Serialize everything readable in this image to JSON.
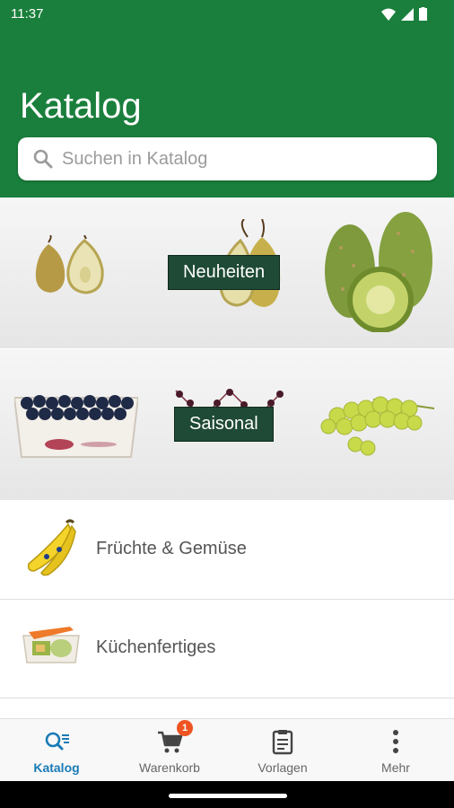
{
  "status_bar": {
    "time": "11:37"
  },
  "header": {
    "title": "Katalog"
  },
  "search": {
    "placeholder": "Suchen in Katalog"
  },
  "banners": [
    {
      "label": "Neuheiten"
    },
    {
      "label": "Saisonal"
    }
  ],
  "categories": [
    {
      "label": "Früchte & Gemüse",
      "icon": "banana-icon"
    },
    {
      "label": "Küchenfertiges",
      "icon": "vegetable-tray-icon"
    }
  ],
  "tabs": [
    {
      "label": "Katalog",
      "icon": "catalog-search-icon",
      "active": true
    },
    {
      "label": "Warenkorb",
      "icon": "cart-icon",
      "badge": "1"
    },
    {
      "label": "Vorlagen",
      "icon": "clipboard-icon"
    },
    {
      "label": "Mehr",
      "icon": "more-vertical-icon"
    }
  ],
  "colors": {
    "brand_green": "#1a7f3c",
    "active_tab": "#1a7bb5",
    "badge": "#ef5322",
    "banner_label_bg": "#1f4a35"
  }
}
